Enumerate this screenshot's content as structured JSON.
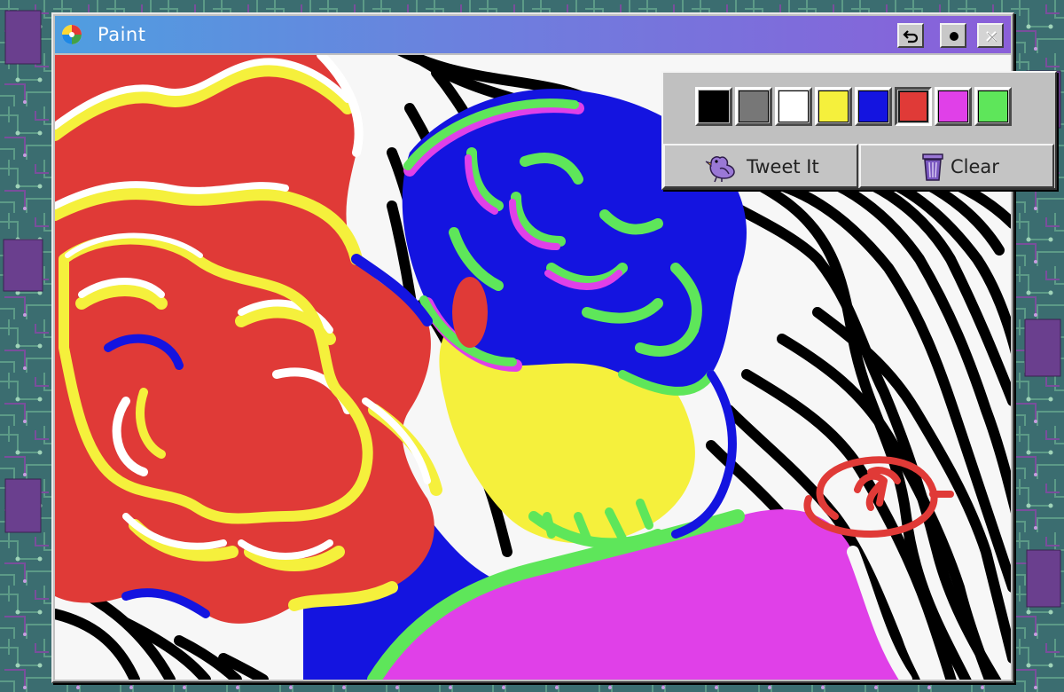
{
  "window": {
    "title": "Paint",
    "app_icon": "color-wheel-icon"
  },
  "titlebar_buttons": [
    {
      "name": "undo-button",
      "icon": "undo-arrow-icon"
    },
    {
      "name": "record-button",
      "icon": "dot-icon"
    },
    {
      "name": "close-button",
      "icon": "close-x-icon",
      "disabled": true
    }
  ],
  "palette": {
    "colors": [
      {
        "name": "black",
        "hex": "#000000"
      },
      {
        "name": "gray",
        "hex": "#777777"
      },
      {
        "name": "white",
        "hex": "#ffffff"
      },
      {
        "name": "yellow",
        "hex": "#f5f03c"
      },
      {
        "name": "blue",
        "hex": "#1414e0"
      },
      {
        "name": "red",
        "hex": "#e03a37"
      },
      {
        "name": "magenta",
        "hex": "#e040e8"
      },
      {
        "name": "green",
        "hex": "#5ee65a"
      }
    ],
    "selected_color": "red",
    "tweet_label": "Tweet It",
    "tweet_icon": "bird-icon",
    "clear_label": "Clear",
    "clear_icon": "trash-can-icon"
  },
  "canvas": {
    "drawing": "user painting"
  }
}
